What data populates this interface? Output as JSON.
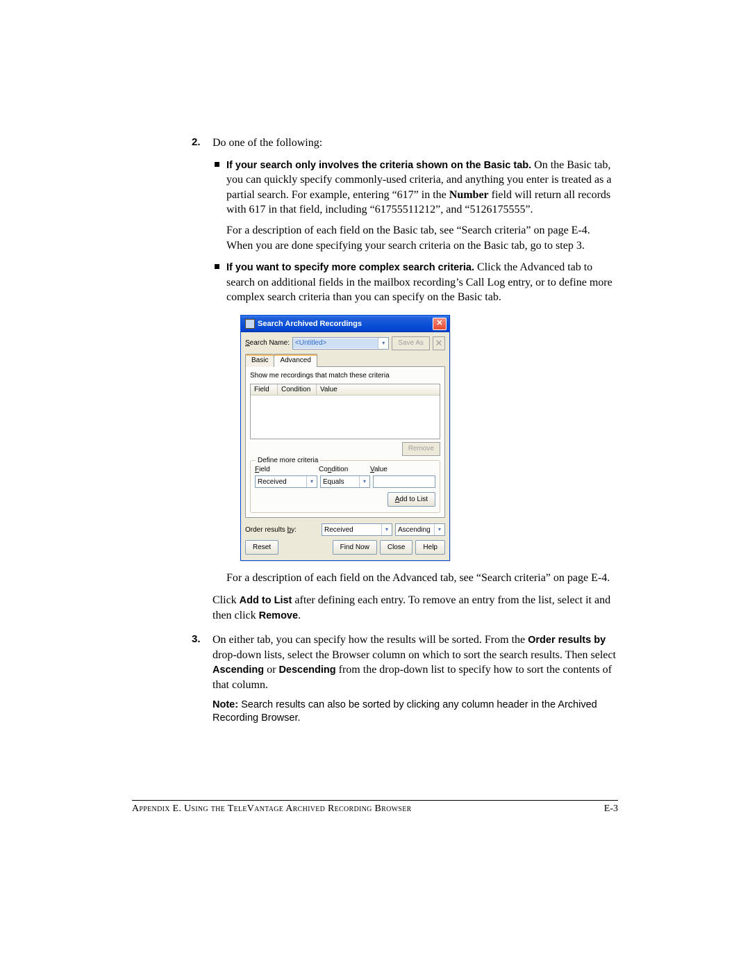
{
  "step2": {
    "num": "2.",
    "lead": "Do one of the following:",
    "bullet1": {
      "bold": "If your search only involves the criteria shown on the Basic tab.",
      "rest": " On the Basic tab, you can quickly specify commonly-used criteria, and anything you enter is treated as a partial search. For example, entering “617” in the ",
      "bold2": "Number",
      "rest2": " field will return all records with 617 in that field, including “61755511212”, and “5126175555”.",
      "p2": "For a description of each field on the Basic tab, see “Search criteria” on page E-4. When you are done specifying your search criteria on the Basic tab, go to step 3."
    },
    "bullet2": {
      "bold": "If you want to specify more complex search criteria.",
      "rest": " Click the Advanced tab to search on additional fields in the mailbox recording’s Call Log entry, or to define more complex search criteria than you can specify on the Basic tab."
    },
    "after_dlg": "For a description of each field on the Advanced tab, see “Search criteria” on page E-4.",
    "after_dlg2a": "Click ",
    "after_dlg2b": "Add to List",
    "after_dlg2c": " after defining each entry. To remove an entry from the list, select it and then click ",
    "after_dlg2d": "Remove",
    "after_dlg2e": "."
  },
  "step3": {
    "num": "3.",
    "p1a": "On either tab, you can specify how the results will be sorted. From the ",
    "p1b": "Order results by",
    "p1c": " drop-down lists, select the Browser column on which to sort the search results. Then select ",
    "p1d": "Ascending",
    "p1e": " or ",
    "p1f": "Descending",
    "p1g": " from the drop-down list to specify how to sort the contents of that column.",
    "note_lead": "Note:  ",
    "note_text": "Search results can also be sorted by clicking any column header in the Archived Recording Browser."
  },
  "dialog": {
    "title": "Search Archived Recordings",
    "close": "✕",
    "search_name_label": "Search Name:",
    "search_name_value": "<Untitled>",
    "save_as": "Save As",
    "tab_basic": "Basic",
    "tab_advanced": "Advanced",
    "instr": "Show me recordings that match these criteria",
    "col_field": "Field",
    "col_cond": "Condition",
    "col_value": "Value",
    "remove": "Remove",
    "legend": "Define more criteria",
    "lbl_field": "Field",
    "lbl_cond": "Condition",
    "lbl_value": "Value",
    "field_val": "Received",
    "cond_val": "Equals",
    "add_to_list": "Add to List",
    "order_by": "Order results by:",
    "order_field": "Received",
    "order_dir": "Ascending",
    "reset": "Reset",
    "find_now": "Find Now",
    "close_btn": "Close",
    "help": "Help"
  },
  "footer": {
    "left": "Appendix E. Using the TeleVantage Archived Recording Browser",
    "right": "E-3"
  }
}
